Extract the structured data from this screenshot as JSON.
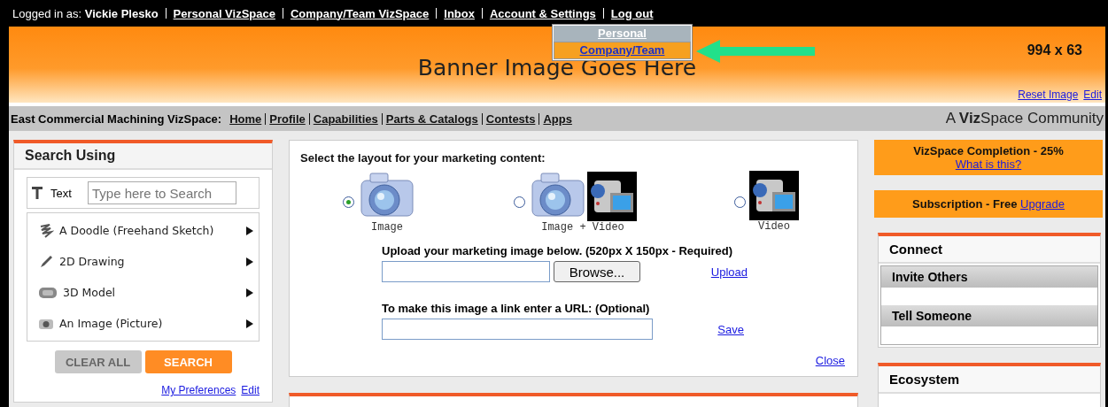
{
  "top_bar": {
    "logged_in_label": "Logged in as:",
    "user": "Vickie Plesko",
    "links": [
      "Personal VizSpace",
      "Company/Team VizSpace",
      "Inbox",
      "Account & Settings",
      "Log out"
    ]
  },
  "account_menu": {
    "items": [
      {
        "label": "Personal",
        "selected": false
      },
      {
        "label": "Company/Team",
        "selected": true
      }
    ]
  },
  "banner": {
    "title": "Banner Image Goes Here",
    "size": "994 x 63",
    "links": [
      "Reset Image",
      "Edit"
    ]
  },
  "nav_bar": {
    "label": "East Commercial Machining VizSpace:",
    "links": [
      "Home",
      "Profile",
      "Capabilities",
      "Parts & Catalogs",
      "Contests",
      "Apps"
    ],
    "tagline": "A **Viz**Space Community"
  },
  "search_panel": {
    "title": "Search Using",
    "text_row": {
      "label": "Text",
      "placeholder": "Type here to Search"
    },
    "options": [
      {
        "kind": "doodle",
        "label": "A Doodle (Freehand Sketch)"
      },
      {
        "kind": "drawing",
        "label": "2D Drawing"
      },
      {
        "kind": "model",
        "label": "3D Model"
      },
      {
        "kind": "image",
        "label": "An Image (Picture)"
      }
    ],
    "buttons": [
      "CLEAR ALL",
      "SEARCH"
    ],
    "links": [
      "My Preferences",
      "Edit"
    ]
  },
  "layout_panel": {
    "prompt": "Select the layout for your marketing content:",
    "layouts": [
      {
        "kind": "image",
        "label": "Image",
        "selected": true
      },
      {
        "kind": "image_video",
        "label": "Image + Video",
        "selected": false
      },
      {
        "kind": "video",
        "label": "Video",
        "selected": false
      }
    ],
    "upload_label": "Upload your marketing image below. (520px X 150px - Required)",
    "browse": "Browse...",
    "upload": "Upload",
    "url_label": "To make this image a link enter a URL: (Optional)",
    "save": "Save",
    "close": "Close"
  },
  "completion": {
    "text": "VizSpace Completion - 25%",
    "link": "What is this?"
  },
  "subscription": {
    "text": "Subscription - Free",
    "link": "Upgrade"
  },
  "connect": {
    "title": "Connect",
    "items": [
      "Invite Others",
      "Tell Someone"
    ]
  },
  "ecosystem": {
    "title": "Ecosystem"
  }
}
